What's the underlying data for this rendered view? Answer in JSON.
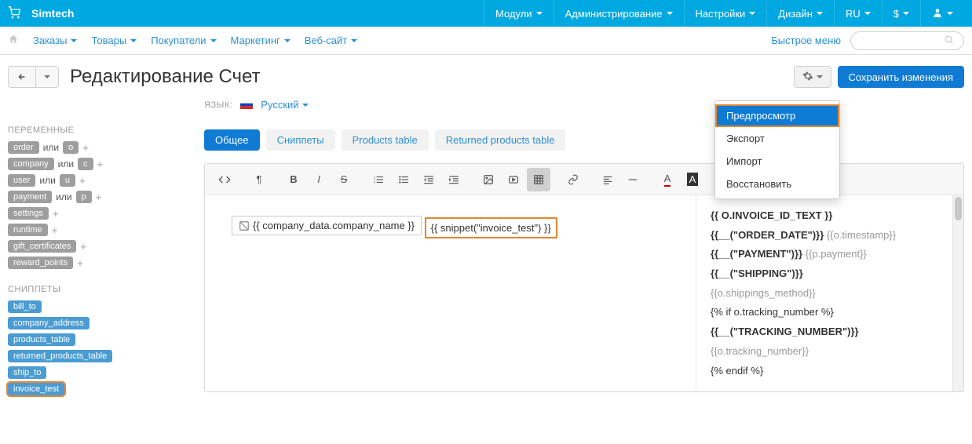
{
  "topbar": {
    "brand": "Simtech",
    "items": [
      "Модули",
      "Администрирование",
      "Настройки",
      "Дизайн",
      "RU",
      "$"
    ]
  },
  "menubar": {
    "items": [
      "Заказы",
      "Товары",
      "Покупатели",
      "Маркетинг",
      "Веб-сайт"
    ],
    "quick_menu": "Быстрое меню"
  },
  "page": {
    "title": "Редактирование Счет",
    "save_label": "Сохранить изменения"
  },
  "dropdown": {
    "items": [
      "Предпросмотр",
      "Экспорт",
      "Импорт",
      "Восстановить"
    ]
  },
  "sidebar": {
    "vars_heading": "ПЕРЕМЕННЫЕ",
    "or_label": "или",
    "vars": [
      {
        "name": "order",
        "short": "o"
      },
      {
        "name": "company",
        "short": "c"
      },
      {
        "name": "user",
        "short": "u"
      },
      {
        "name": "payment",
        "short": "p"
      },
      {
        "name": "settings",
        "short": null
      },
      {
        "name": "runtime",
        "short": null
      },
      {
        "name": "gift_certificates",
        "short": null
      },
      {
        "name": "reward_points",
        "short": null
      }
    ],
    "snip_heading": "СНИППЕТЫ",
    "snippets": [
      {
        "name": "bill_to",
        "hl": false
      },
      {
        "name": "company_address",
        "hl": false
      },
      {
        "name": "products_table",
        "hl": false
      },
      {
        "name": "returned_products_table",
        "hl": false
      },
      {
        "name": "ship_to",
        "hl": false
      },
      {
        "name": "invoice_test",
        "hl": true
      }
    ]
  },
  "main": {
    "lang_label": "ЯЗЫК:",
    "lang_value": "Русский",
    "tabs": [
      "Общее",
      "Сниппеты",
      "Products table",
      "Returned products table"
    ]
  },
  "editor": {
    "company_line": "{{ company_data.company_name }}",
    "snippet_line": "{{ snippet(\"invoice_test\") }}",
    "right": {
      "line1_bold": "{{ O.INVOICE_ID_TEXT }}",
      "line2_bold": "{{__(\"ORDER_DATE\")}}",
      "line2_muted": " {{o.timestamp}}",
      "line3_bold": "{{__(\"PAYMENT\")}}",
      "line3_muted": " {{p.payment}}",
      "line4_bold": "{{__(\"SHIPPING\")}}",
      "line5_muted": "{{o.shippings_method}}",
      "line6": "{% if o.tracking_number %}",
      "line7_bold": "{{__(\"TRACKING_NUMBER\")}}",
      "line8_muted": "{{o.tracking_number}}",
      "line9": "{% endif %}"
    }
  }
}
